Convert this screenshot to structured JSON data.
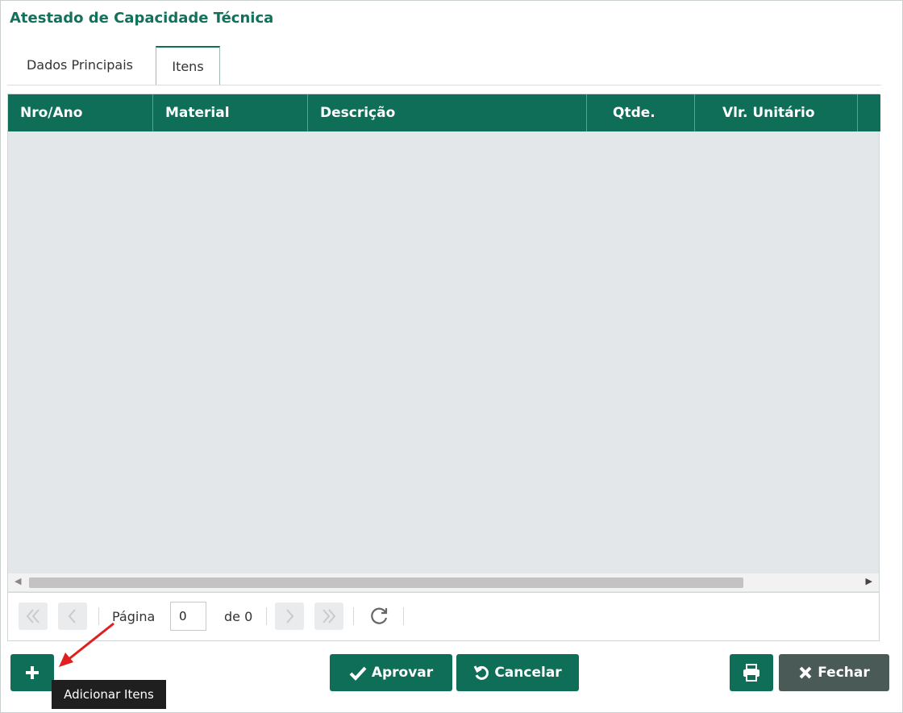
{
  "window": {
    "title": "Atestado de Capacidade Técnica"
  },
  "tabs": [
    {
      "label": "Dados Principais",
      "active": false
    },
    {
      "label": "Itens",
      "active": true
    }
  ],
  "grid": {
    "columns": [
      "Nro/Ano",
      "Material",
      "Descrição",
      "Qtde.",
      "Vlr. Unitário"
    ],
    "rows": []
  },
  "pager": {
    "page_label": "Página",
    "page_value": "0",
    "of_label": "de 0"
  },
  "buttons": {
    "add_icon": "plus-icon",
    "aprovar": "Aprovar",
    "cancelar": "Cancelar",
    "print_icon": "printer-icon",
    "fechar": "Fechar"
  },
  "tooltip": {
    "text": "Adicionar Itens"
  },
  "colors": {
    "accent": "#0e6e58",
    "grid_bg": "#e3e7e9",
    "fechar_bg": "#4a5a57",
    "annotation": "#e02020"
  }
}
